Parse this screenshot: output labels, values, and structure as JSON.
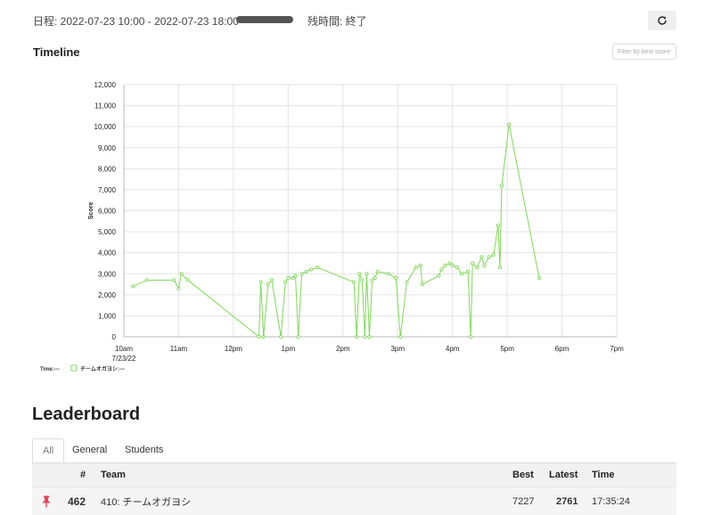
{
  "header": {
    "schedule": "日程: 2022-07-23 10:00 - 2022-07-23 18:00",
    "progress": 1.0,
    "remaining": "残時間: 終了",
    "refresh_icon": "refresh-icon"
  },
  "timeline": {
    "title": "Timeline",
    "filter_placeholder": "Filter by best score"
  },
  "chart_data": {
    "type": "line",
    "ylabel": "Score",
    "y_ticks": [
      "0",
      "1,000",
      "2,000",
      "3,000",
      "4,000",
      "5,000",
      "6,000",
      "7,000",
      "8,000",
      "9,000",
      "10,000",
      "11,000",
      "12,000"
    ],
    "x_ticks": [
      "10am",
      "11am",
      "12pm",
      "1pm",
      "2pm",
      "3pm",
      "4pm",
      "5pm",
      "6pm",
      "7pm"
    ],
    "x_date_label": "7/23/22",
    "ylim": [
      0,
      12000
    ],
    "xlim": [
      "2022-07-23 10:00",
      "2022-07-23 19:00"
    ],
    "grid": true,
    "legend_position": "bottom-left",
    "legend": {
      "time_label": "Time:---",
      "series_label": "チームオガヨシ:---"
    },
    "series": [
      {
        "name": "チームオガヨシ",
        "color": "#7ed957",
        "points": [
          [
            "10:10",
            2400
          ],
          [
            "10:25",
            2700
          ],
          [
            "10:55",
            2700
          ],
          [
            "11:00",
            2300
          ],
          [
            "11:03",
            3000
          ],
          [
            "11:10",
            2700
          ],
          [
            "12:28",
            0
          ],
          [
            "12:30",
            2600
          ],
          [
            "12:33",
            0
          ],
          [
            "12:38",
            2500
          ],
          [
            "12:42",
            2700
          ],
          [
            "12:52",
            0
          ],
          [
            "12:57",
            2600
          ],
          [
            "13:00",
            2800
          ],
          [
            "13:05",
            2800
          ],
          [
            "13:08",
            2900
          ],
          [
            "13:11",
            0
          ],
          [
            "13:15",
            3000
          ],
          [
            "13:20",
            3100
          ],
          [
            "13:25",
            3200
          ],
          [
            "13:32",
            3300
          ],
          [
            "14:12",
            2600
          ],
          [
            "14:15",
            0
          ],
          [
            "14:18",
            3000
          ],
          [
            "14:21",
            2700
          ],
          [
            "14:24",
            0
          ],
          [
            "14:26",
            3000
          ],
          [
            "14:29",
            0
          ],
          [
            "14:32",
            2700
          ],
          [
            "14:35",
            2800
          ],
          [
            "14:38",
            3100
          ],
          [
            "14:50",
            3000
          ],
          [
            "14:58",
            2800
          ],
          [
            "15:03",
            0
          ],
          [
            "15:10",
            2600
          ],
          [
            "15:20",
            3300
          ],
          [
            "15:25",
            3400
          ],
          [
            "15:27",
            2500
          ],
          [
            "15:45",
            2900
          ],
          [
            "15:48",
            3200
          ],
          [
            "15:52",
            3400
          ],
          [
            "15:57",
            3500
          ],
          [
            "16:00",
            3400
          ],
          [
            "16:05",
            3300
          ],
          [
            "16:10",
            3000
          ],
          [
            "16:17",
            3100
          ],
          [
            "16:20",
            0
          ],
          [
            "16:22",
            3500
          ],
          [
            "16:27",
            3300
          ],
          [
            "16:32",
            3800
          ],
          [
            "16:35",
            3400
          ],
          [
            "16:40",
            3800
          ],
          [
            "16:45",
            3900
          ],
          [
            "16:50",
            5300
          ],
          [
            "16:52",
            3300
          ],
          [
            "16:54",
            7200
          ],
          [
            "17:02",
            10100
          ],
          [
            "17:35",
            2800
          ]
        ]
      }
    ]
  },
  "leaderboard": {
    "title": "Leaderboard",
    "tabs": [
      "All",
      "General",
      "Students"
    ],
    "active_tab": "All",
    "columns": {
      "rank": "#",
      "team": "Team",
      "best": "Best",
      "latest": "Latest",
      "time": "Time"
    },
    "rows": [
      {
        "pin_icon": "pin-icon",
        "rank": "462",
        "team": "410: チームオガヨシ",
        "best": "7227",
        "latest": "2761",
        "time": "17:35:24"
      }
    ]
  }
}
